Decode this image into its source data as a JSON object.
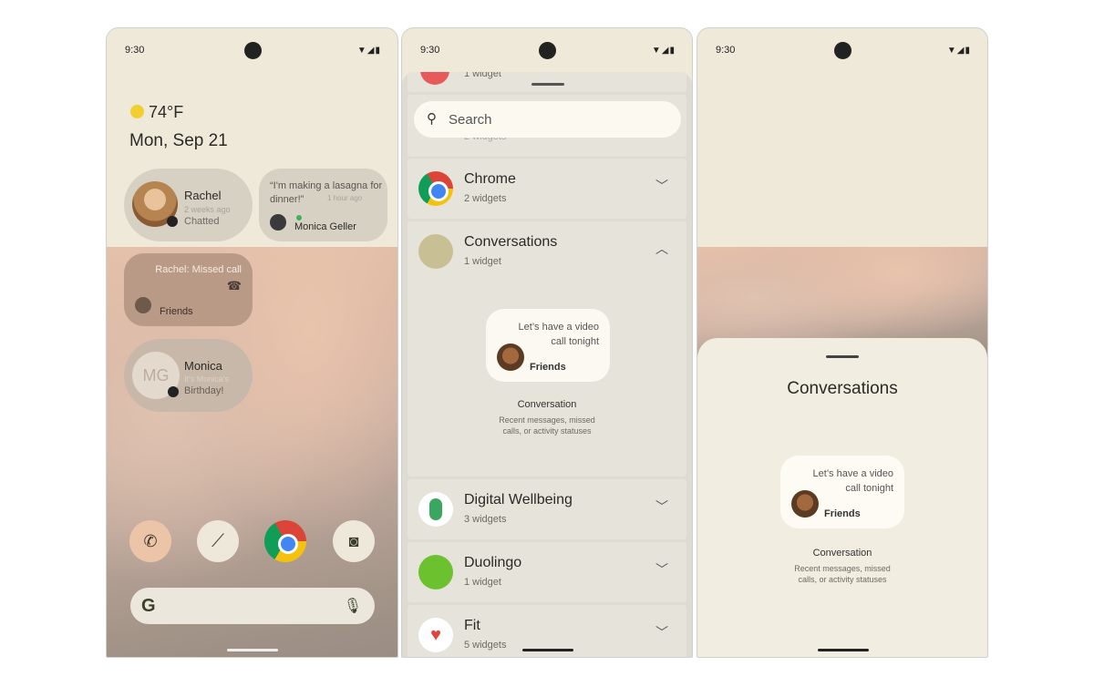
{
  "status": {
    "time": "9:30",
    "icons": "▼◢▮"
  },
  "home": {
    "weather": {
      "temp": "74°F",
      "icon": "sun-icon"
    },
    "date": "Mon, Sep 21",
    "rachel": {
      "name": "Rachel",
      "time": "2 weeks ago",
      "status": "Chatted"
    },
    "monica_quote": {
      "text": "“I'm making a lasagna for dinner!”",
      "time": "1 hour ago",
      "name": "Monica Geller"
    },
    "missed": {
      "text": "Rachel: Missed call",
      "group": "Friends"
    },
    "monica_bday": {
      "initials": "MG",
      "name": "Monica",
      "line1": "It's Monica's",
      "line2": "Birthday!"
    },
    "dock": [
      "phone",
      "clock",
      "chrome",
      "camera"
    ],
    "search_logo": "G"
  },
  "picker": {
    "top_partial": "1 widget",
    "search_placeholder": "Search",
    "hidden_partial": "2 widgets",
    "apps": [
      {
        "name": "Chrome",
        "count": "2 widgets",
        "expanded": false
      },
      {
        "name": "Conversations",
        "count": "1 widget",
        "expanded": true
      },
      {
        "name": "Digital Wellbeing",
        "count": "3 widgets",
        "expanded": false
      },
      {
        "name": "Duolingo",
        "count": "1 widget",
        "expanded": false
      },
      {
        "name": "Fit",
        "count": "5 widgets",
        "expanded": false
      }
    ],
    "preview": {
      "message": "Let’s have a video call tonight",
      "group": "Friends",
      "title": "Conversation",
      "desc1": "Recent messages, missed",
      "desc2": "calls, or activity statuses"
    }
  },
  "detail": {
    "title": "Conversations",
    "preview": {
      "line1": "Let’s have a video",
      "line2": "call tonight",
      "group": "Friends",
      "title": "Conversation",
      "desc1": "Recent messages, missed",
      "desc2": "calls, or activity statuses"
    }
  }
}
